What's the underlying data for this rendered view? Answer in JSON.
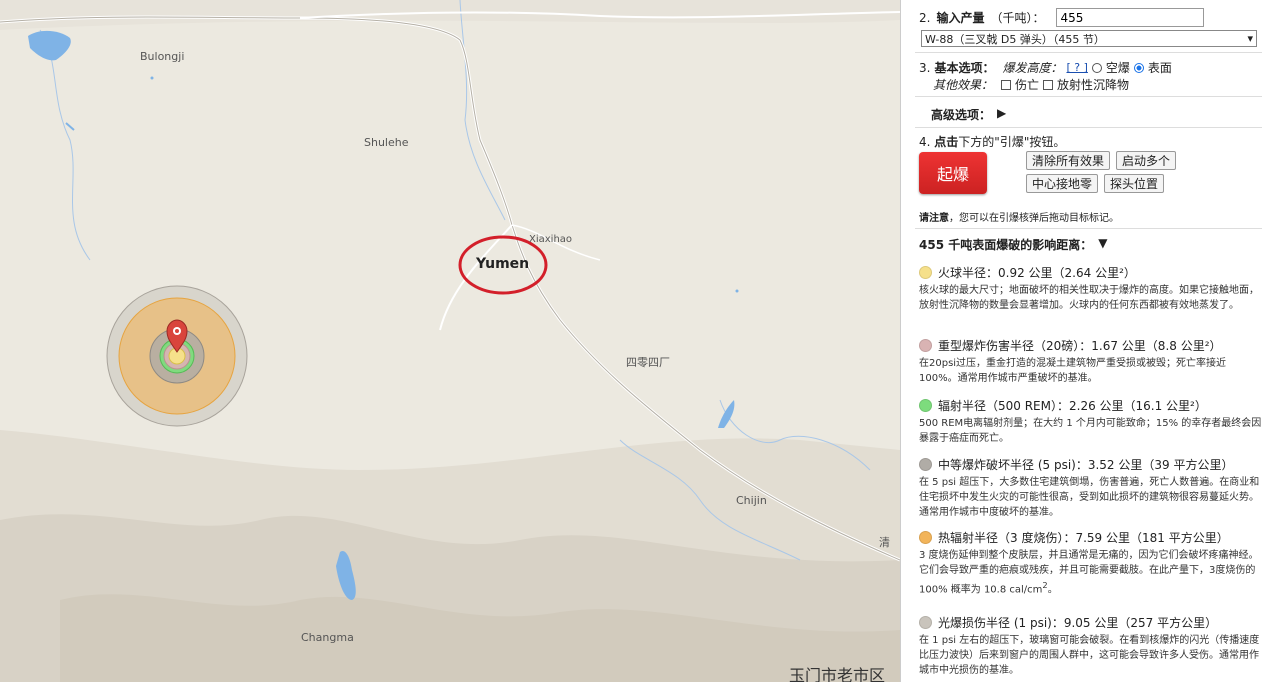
{
  "map": {
    "labels": {
      "bulongji": "Bulongji",
      "shulehe": "Shulehe",
      "xiaxihao": "Xiaxihao",
      "yumen": "Yumen",
      "sisiling": "四零四厂",
      "chijin": "Chijin",
      "changma": "Changma",
      "qing": "清",
      "yumen_old": "玉门市老市区"
    },
    "colors": {
      "fireball": "#f6e08a",
      "heavy_blast": "#d9b3b3",
      "radiation": "#7ddc7d",
      "moderate_blast": "#b0aca6",
      "thermal": "#f2b45a",
      "light_blast": "#c9c4bc",
      "highlight_circle": "#d31f2a",
      "marker": "#d9453c",
      "water": "#7fb3e6"
    }
  },
  "panel": {
    "step2": {
      "num": "2.",
      "label": "输入产量",
      "unit": "（千吨）：",
      "value": "455"
    },
    "preset": {
      "selected": "W-88（三叉戟 D5 弹头）（455 节）",
      "arrow": "▾"
    },
    "step3": {
      "num": "3.",
      "label": "基本选项：",
      "burst_label": "爆发高度：",
      "help": "[ ? ]",
      "airburst": "空爆",
      "surface": "表面",
      "other_label": "其他效果：",
      "casualties": "伤亡",
      "fallout": "放射性沉降物"
    },
    "advanced": {
      "label": "高级选项：",
      "arrow": "▶"
    },
    "step4": {
      "num": "4.",
      "bold": "点击",
      "text": "下方的\"引爆\"按钮。"
    },
    "buttons": {
      "detonate": "起爆",
      "clear": "清除所有效果",
      "multi": "启动多个",
      "center": "中心接地零",
      "probe": "探头位置"
    },
    "note": {
      "bold": "请注意",
      "text": "，您可以在引爆核弹后拖动目标标记。"
    },
    "results_title": "455 千吨表面爆破的影响距离：",
    "results_arrow": "▼",
    "effects": [
      {
        "title": "火球半径：0.92 公里（2.64 公里²）",
        "desc": "核火球的最大尺寸；地面破坏的相关性取决于爆炸的高度。如果它接触地面，放射性沉降物的数量会显著增加。火球内的任何东西都被有效地蒸发了。"
      },
      {
        "title": "重型爆炸伤害半径（20磅）：1.67 公里（8.8 公里²）",
        "desc": "在20psi过压，重金打造的混凝土建筑物严重受损或被毁；死亡率接近100%。通常用作城市严重破坏的基准。"
      },
      {
        "title": "辐射半径（500 REM）：2.26 公里（16.1 公里²）",
        "desc": "500 REM电离辐射剂量；在大约 1 个月内可能致命；15% 的幸存者最终会因暴露于癌症而死亡。"
      },
      {
        "title": "中等爆炸破坏半径 (5 psi)：3.52 公里（39 平方公里）",
        "desc": "在 5 psi 超压下，大多数住宅建筑倒塌，伤害普遍，死亡人数普遍。在商业和住宅损坏中发生火灾的可能性很高，受到如此损坏的建筑物很容易蔓延火势。通常用作城市中度破坏的基准。"
      },
      {
        "title": "热辐射半径（3 度烧伤）：7.59 公里（181 平方公里）",
        "desc": "3 度烧伤延伸到整个皮肤层，并且通常是无痛的，因为它们会破坏疼痛神经。它们会导致严重的疤痕或残疾，并且可能需要截肢。在此产量下，3度烧伤的 100% 概率为 10.8 cal/cm",
        "sup": "2",
        "tail": "。"
      },
      {
        "title": "光爆损伤半径 (1 psi)：9.05 公里（257 平方公里）",
        "desc": "在 1 psi 左右的超压下，玻璃窗可能会破裂。在看到核爆炸的闪光（传播速度比压力波快）后来到窗户的周围人群中，这可能会导致许多人受伤。通常用作城市中光损伤的基准。"
      }
    ]
  }
}
